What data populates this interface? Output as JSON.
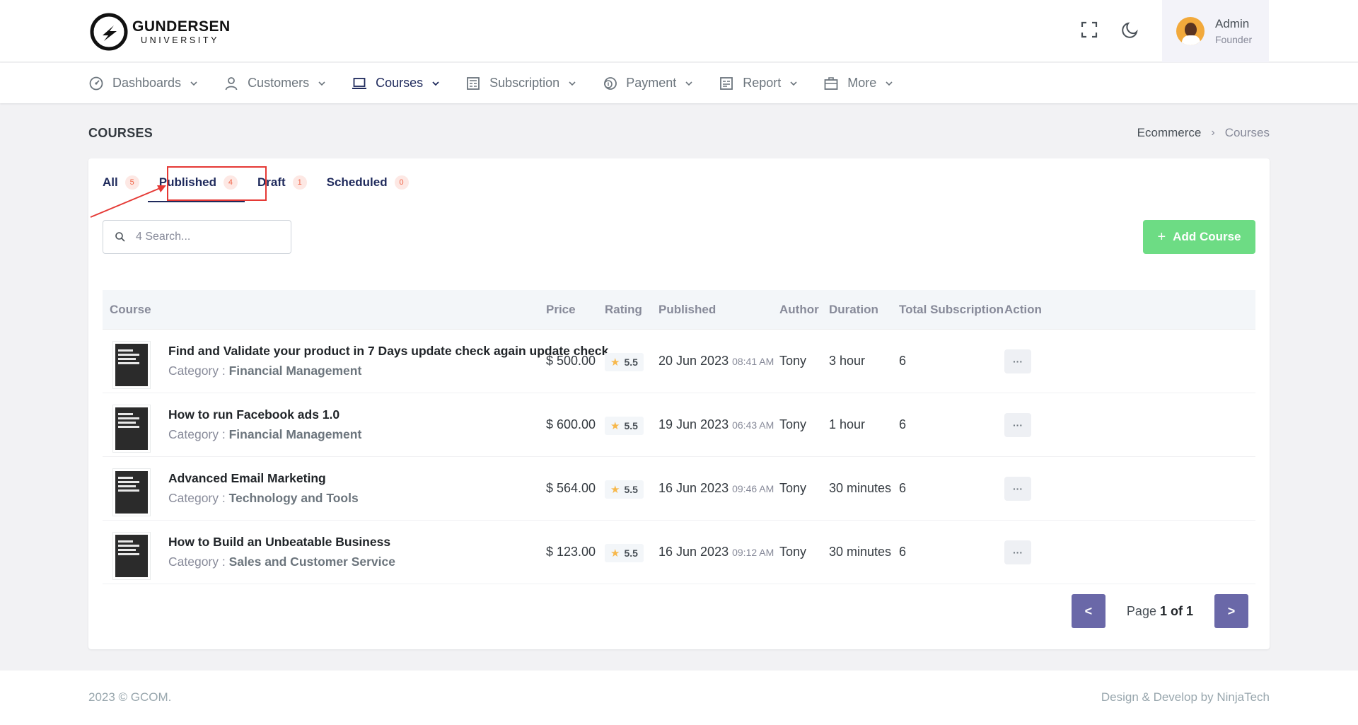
{
  "brand": {
    "name": "GUNDERSEN",
    "subtitle": "UNIVERSITY"
  },
  "user": {
    "name": "Admin",
    "role": "Founder"
  },
  "nav": [
    {
      "label": "Dashboards",
      "icon": "dashboard-icon"
    },
    {
      "label": "Customers",
      "icon": "user-icon"
    },
    {
      "label": "Courses",
      "icon": "laptop-icon"
    },
    {
      "label": "Subscription",
      "icon": "newspaper-icon"
    },
    {
      "label": "Payment",
      "icon": "coin-icon"
    },
    {
      "label": "Report",
      "icon": "report-icon"
    },
    {
      "label": "More",
      "icon": "briefcase-icon"
    }
  ],
  "active_nav": "Courses",
  "page": {
    "title": "COURSES",
    "breadcrumb": [
      "Ecommerce",
      "Courses"
    ]
  },
  "tabs": [
    {
      "label": "All",
      "count": "5"
    },
    {
      "label": "Published",
      "count": "4"
    },
    {
      "label": "Draft",
      "count": "1"
    },
    {
      "label": "Scheduled",
      "count": "0"
    }
  ],
  "active_tab": "Published",
  "search": {
    "placeholder": "4 Search..."
  },
  "add_button": "Add Course",
  "table": {
    "headers": [
      "Course",
      "Price",
      "Rating",
      "Published",
      "Author",
      "Duration",
      "Total Subscription",
      "Action"
    ],
    "category_label": "Category : ",
    "rows": [
      {
        "title": "Find and Validate your product in 7 Days update check again update check",
        "category": "Financial Management",
        "price": "$ 500.00",
        "rating": "5.5",
        "date": "20 Jun 2023",
        "time": "08:41 AM",
        "author": "Tony",
        "duration": "3 hour",
        "subs": "6",
        "action": "···"
      },
      {
        "title": "How to run Facebook ads 1.0",
        "category": "Financial Management",
        "price": "$ 600.00",
        "rating": "5.5",
        "date": "19 Jun 2023",
        "time": "06:43 AM",
        "author": "Tony",
        "duration": "1 hour",
        "subs": "6",
        "action": "···"
      },
      {
        "title": "Advanced Email Marketing",
        "category": "Technology and Tools",
        "price": "$ 564.00",
        "rating": "5.5",
        "date": "16 Jun 2023",
        "time": "09:46 AM",
        "author": "Tony",
        "duration": "30 minutes",
        "subs": "6",
        "action": "···"
      },
      {
        "title": "How to Build an Unbeatable Business",
        "category": "Sales and Customer Service",
        "price": "$ 123.00",
        "rating": "5.5",
        "date": "16 Jun 2023",
        "time": "09:12 AM",
        "author": "Tony",
        "duration": "30 minutes",
        "subs": "6",
        "action": "···"
      }
    ]
  },
  "pagination": {
    "prev": "<",
    "next": ">",
    "label": "Page",
    "current": "1 of 1"
  },
  "footer": {
    "left": "2023 © GCOM.",
    "right": "Design & Develop by NinjaTech"
  },
  "colors": {
    "accent": "#1f2a5c",
    "add_button": "#6ddc84",
    "pager": "#6a68a8",
    "badge_bg": "#fde8e4",
    "badge_text": "#f06548",
    "annotation": "#e53935"
  }
}
